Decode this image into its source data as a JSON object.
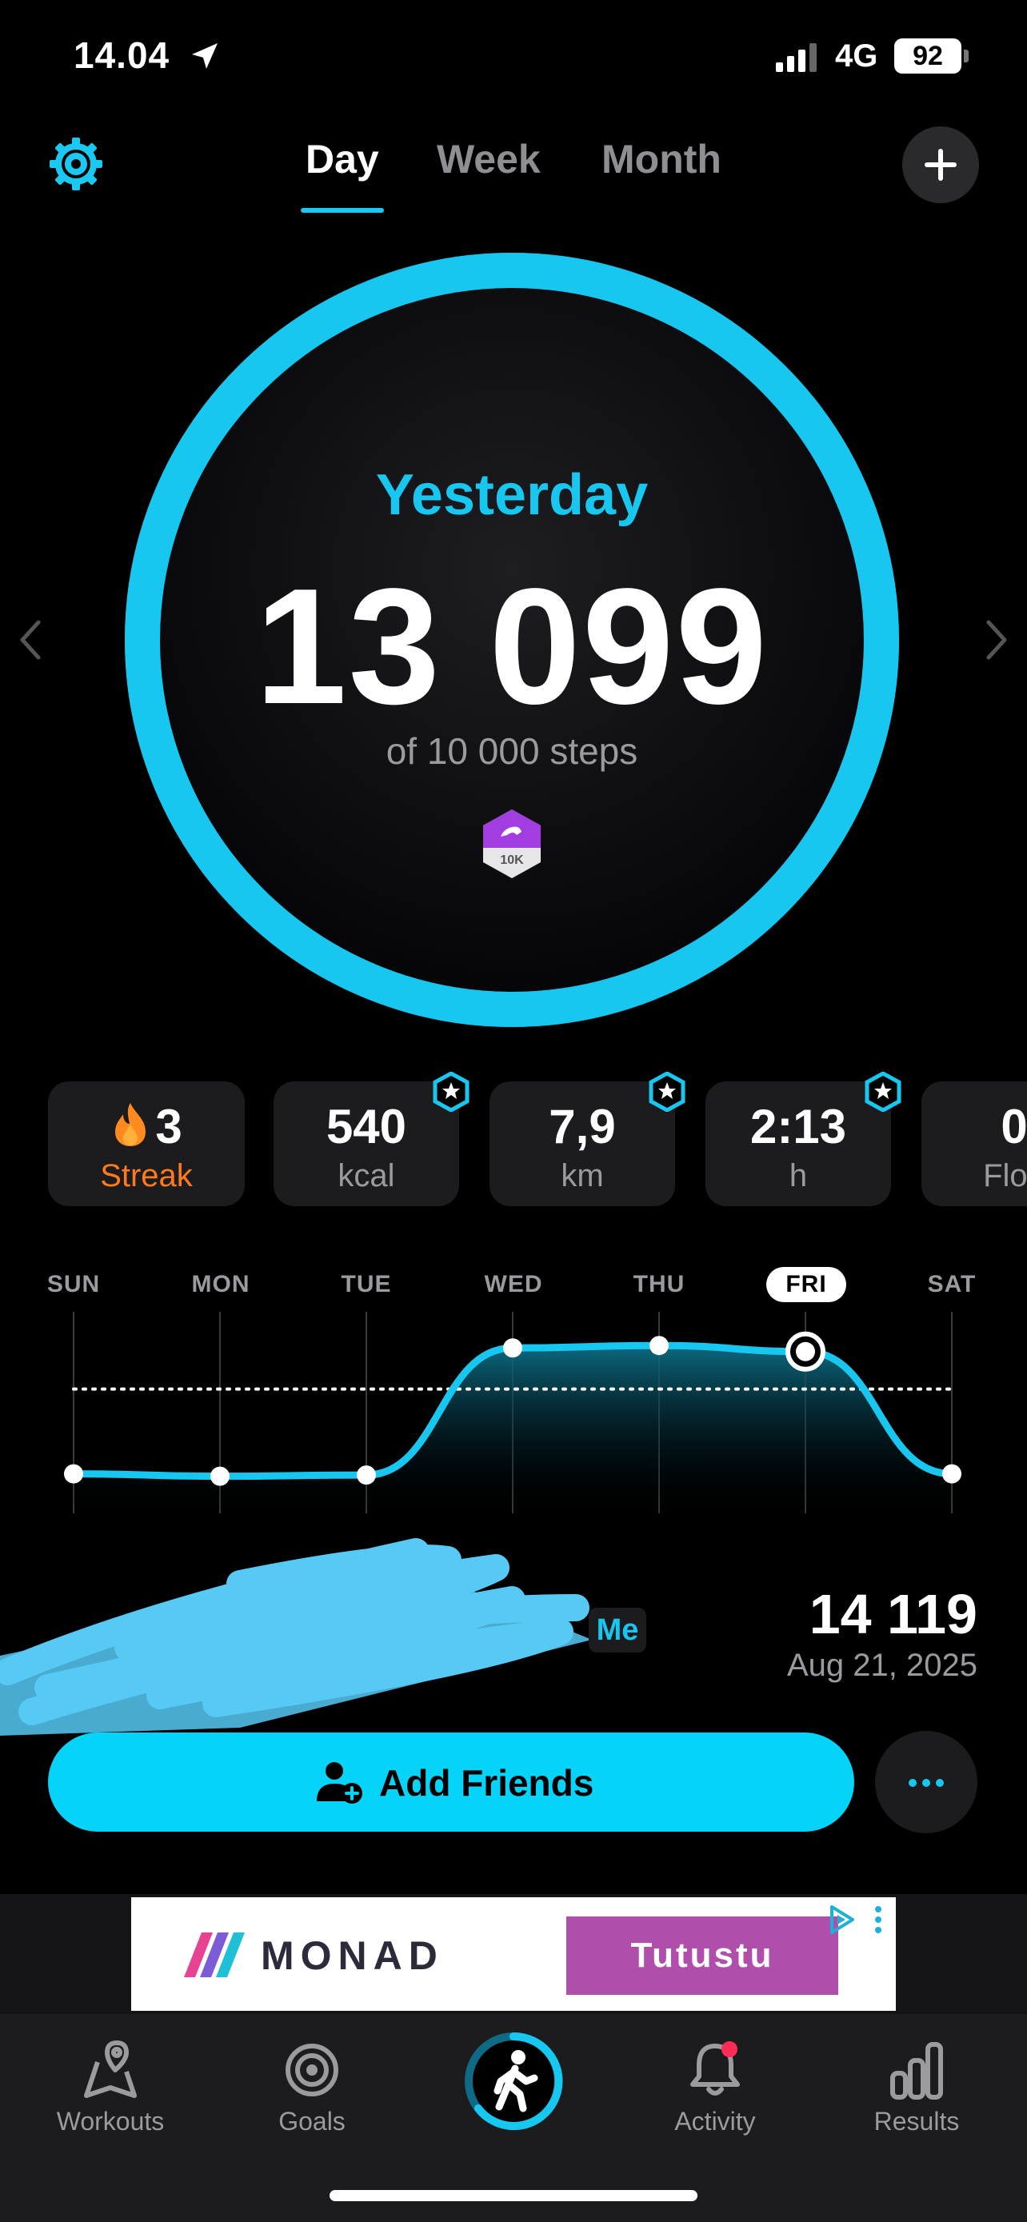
{
  "status_bar": {
    "time": "14.04",
    "network": "4G",
    "battery": "92"
  },
  "header": {
    "tabs": [
      {
        "label": "Day",
        "active": true
      },
      {
        "label": "Week",
        "active": false
      },
      {
        "label": "Month",
        "active": false
      }
    ]
  },
  "ring": {
    "label": "Yesterday",
    "steps": "13 099",
    "goal_text": "of 10 000 steps",
    "badge_text": "10K",
    "progress": 1.3099,
    "accent": "#17c7f0"
  },
  "stats": [
    {
      "value": "3",
      "label": "Streak",
      "icon": "flame-icon",
      "star": false
    },
    {
      "value": "540",
      "label": "kcal",
      "star": true
    },
    {
      "value": "7,9",
      "label": "km",
      "star": true
    },
    {
      "value": "2:13",
      "label": "h",
      "star": true
    },
    {
      "value": "0",
      "label": "Floo",
      "star": false
    }
  ],
  "chart_data": {
    "type": "area",
    "categories": [
      "SUN",
      "MON",
      "TUE",
      "WED",
      "THU",
      "FRI",
      "SAT"
    ],
    "today": "FRI",
    "values": [
      3000,
      2800,
      2900,
      13400,
      13600,
      13099,
      3000
    ],
    "goal": 10000,
    "color": "#17c7f0",
    "grid": true
  },
  "friends": {
    "me_label": "Me",
    "best_value": "14 119",
    "best_date": "Aug 21, 2025",
    "add_friends_label": "Add Friends"
  },
  "ad": {
    "brand": "MONAD",
    "cta": "Tutustu",
    "cta_color": "#b04fab"
  },
  "tabbar": {
    "items": [
      {
        "label": "Workouts",
        "icon": "map-pin-icon"
      },
      {
        "label": "Goals",
        "icon": "target-icon"
      },
      {
        "label": "Activity",
        "icon": "bell-icon"
      },
      {
        "label": "Results",
        "icon": "bar-chart-icon"
      }
    ]
  }
}
